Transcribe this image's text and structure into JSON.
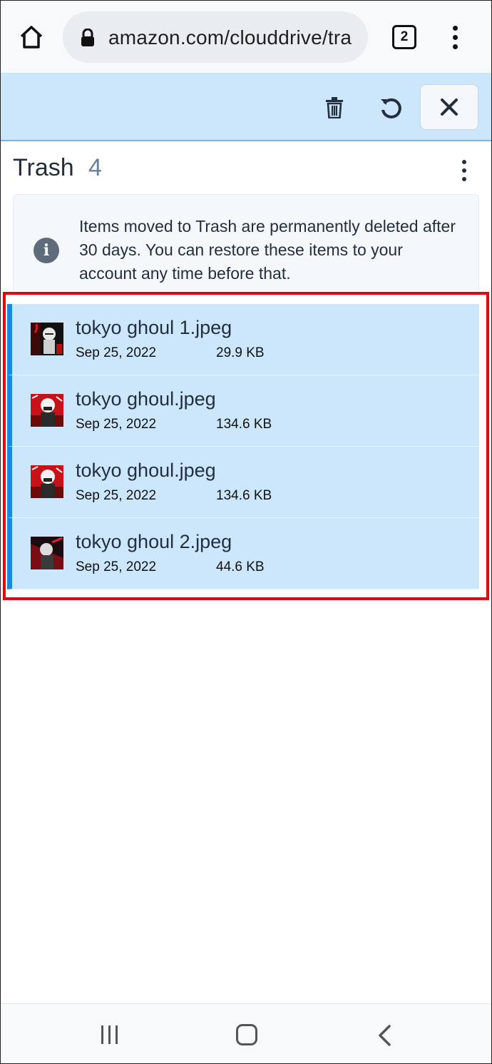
{
  "browser": {
    "url": "amazon.com/clouddrive/tra",
    "tab_count": "2",
    "icons": [
      "home-icon",
      "lock-icon",
      "tabs-icon",
      "overflow-menu-icon"
    ]
  },
  "toolbar": {
    "icons": [
      "trash-icon",
      "restore-icon",
      "close-icon"
    ]
  },
  "header": {
    "title": "Trash",
    "count": "4"
  },
  "info": {
    "text": "Items moved to Trash are permanently deleted after 30 days. You can restore these items to your account any time before that."
  },
  "files": [
    {
      "name": "tokyo ghoul 1.jpeg",
      "date": "Sep 25, 2022",
      "size": "29.9 KB",
      "selected": true
    },
    {
      "name": "tokyo ghoul.jpeg",
      "date": "Sep 25, 2022",
      "size": "134.6 KB",
      "selected": true
    },
    {
      "name": "tokyo ghoul.jpeg",
      "date": "Sep 25, 2022",
      "size": "134.6 KB",
      "selected": true
    },
    {
      "name": "tokyo ghoul 2.jpeg",
      "date": "Sep 25, 2022",
      "size": "44.6 KB",
      "selected": true
    }
  ],
  "colors": {
    "selection": "#cce6fb",
    "accent": "#1a86e5",
    "highlight_border": "#e8000c",
    "text": "#232f3e"
  },
  "navbar": {
    "icons": [
      "recents-icon",
      "home-nav-icon",
      "back-icon"
    ]
  }
}
